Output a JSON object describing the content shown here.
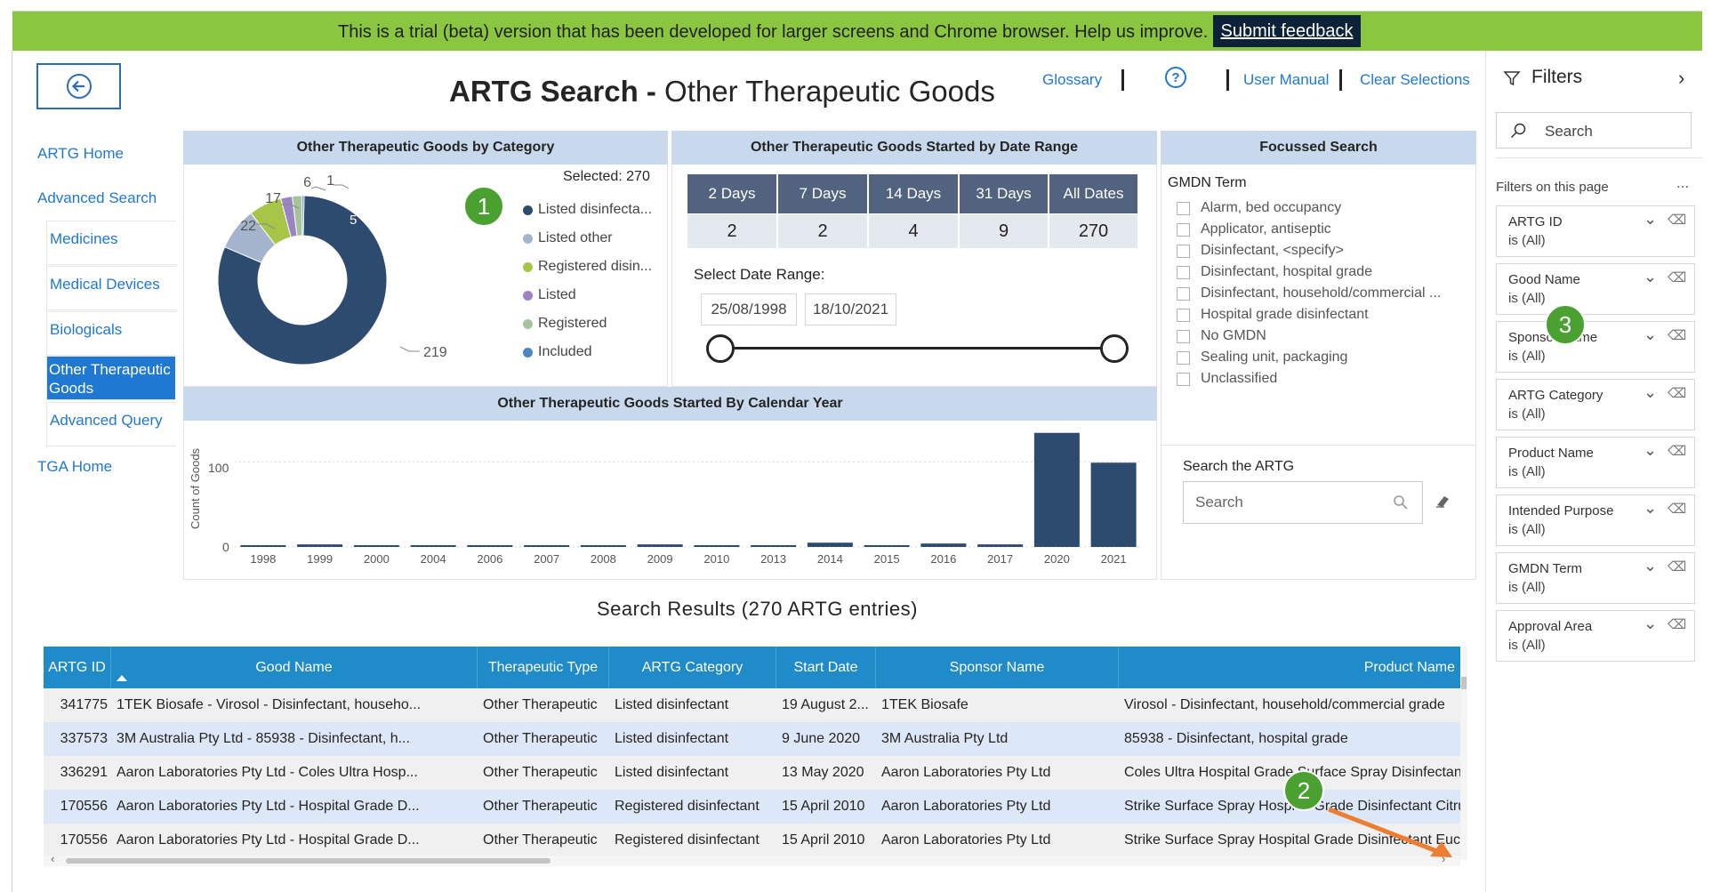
{
  "banner": {
    "text": "This is a trial (beta) version that has been developed for larger screens and Chrome browser. Help us improve.",
    "feedback_label": "Submit feedback"
  },
  "header": {
    "title_bold": "ARTG Search -",
    "title_rest": " Other Therapeutic Goods",
    "glossary": "Glossary",
    "help": "?",
    "user_manual": "User Manual",
    "clear_selections": "Clear Selections"
  },
  "sidebar": {
    "artg_home": "ARTG Home",
    "advanced_search": "Advanced Search",
    "items": [
      "Medicines",
      "Medical Devices",
      "Biologicals",
      "Other Therapeutic Goods",
      "Advanced Query"
    ],
    "tga_home": "TGA Home"
  },
  "category_panel": {
    "title": "Other Therapeutic Goods by Category",
    "selected": "Selected: 270",
    "legend": [
      {
        "label": "Listed disinfecta...",
        "color": "#2d4a6f"
      },
      {
        "label": "Listed other",
        "color": "#a4b4cd"
      },
      {
        "label": "Registered disin...",
        "color": "#a7c648"
      },
      {
        "label": "Listed",
        "color": "#9b84c3"
      },
      {
        "label": "Registered",
        "color": "#a6c49a"
      },
      {
        "label": "Included",
        "color": "#4a86c6"
      }
    ],
    "data_labels": [
      "17",
      "6",
      "1",
      "5",
      "22",
      "219"
    ]
  },
  "chart_data": {
    "type": "pie",
    "title": "Other Therapeutic Goods by Category",
    "categories": [
      "Listed disinfectant",
      "Listed other",
      "Registered disinfectant",
      "Listed",
      "Registered",
      "Included"
    ],
    "values": [
      219,
      22,
      17,
      6,
      5,
      1
    ]
  },
  "date_panel": {
    "title": "Other Therapeutic Goods Started by Date Range",
    "tabs": [
      {
        "label": "2 Days",
        "value": "2"
      },
      {
        "label": "7 Days",
        "value": "2"
      },
      {
        "label": "14 Days",
        "value": "4"
      },
      {
        "label": "31 Days",
        "value": "9"
      },
      {
        "label": "All Dates",
        "value": "270"
      }
    ],
    "select_label": "Select Date Range:",
    "start_date": "25/08/1998",
    "end_date": "18/10/2021"
  },
  "focus_panel": {
    "title": "Focussed Search",
    "gmdn_label": "GMDN Term",
    "terms": [
      "Alarm, bed occupancy",
      "Applicator, antiseptic",
      "Disinfectant, <specify>",
      "Disinfectant, hospital grade",
      "Disinfectant, household/commercial ...",
      "Hospital grade disinfectant",
      "No GMDN",
      "Sealing unit, packaging",
      "Unclassified"
    ],
    "search_label": "Search the ARTG",
    "search_placeholder": "Search"
  },
  "year_chart": {
    "title": "Other Therapeutic Goods Started By Calendar Year",
    "ylabel": "Count of Goods",
    "yticks": [
      "100",
      "0"
    ],
    "years": [
      "1998",
      "1999",
      "2000",
      "2004",
      "2006",
      "2007",
      "2008",
      "2009",
      "2010",
      "2013",
      "2014",
      "2015",
      "2016",
      "2017",
      "2020",
      "2021"
    ],
    "values": [
      1,
      3,
      1,
      1,
      1,
      1,
      2,
      3,
      2,
      1,
      5,
      1,
      4,
      3,
      134,
      99
    ],
    "ymax": 140
  },
  "results": {
    "title": "Search Results (270 ARTG entries)",
    "columns": [
      "ARTG ID",
      "Good Name",
      "Therapeutic Type",
      "ARTG Category",
      "Start Date",
      "Sponsor Name",
      "Product Name"
    ],
    "rows": [
      [
        "341775",
        "1TEK Biosafe - Virosol - Disinfectant, househo...",
        "Other Therapeutic",
        "Listed disinfectant",
        "19 August 2...",
        "1TEK Biosafe",
        "Virosol - Disinfectant, household/commercial grade"
      ],
      [
        "337573",
        "3M Australia Pty Ltd - 85938 - Disinfectant, h...",
        "Other Therapeutic",
        "Listed disinfectant",
        "9 June 2020",
        "3M Australia Pty Ltd",
        "85938 - Disinfectant, hospital grade"
      ],
      [
        "336291",
        "Aaron Laboratories Pty Ltd - Coles Ultra Hosp...",
        "Other Therapeutic",
        "Listed disinfectant",
        "13 May 2020",
        "Aaron Laboratories Pty Ltd",
        "Coles Ultra Hospital Grade Surface Spray Disinfectant - Di"
      ],
      [
        "170556",
        "Aaron Laboratories Pty Ltd - Hospital Grade D...",
        "Other Therapeutic",
        "Registered disinfectant",
        "15 April 2010",
        "Aaron Laboratories Pty Ltd",
        "Strike Surface Spray Hospital Grade Disinfectant Citrus Fre"
      ],
      [
        "170556",
        "Aaron Laboratories Pty Ltd - Hospital Grade D...",
        "Other Therapeutic",
        "Registered disinfectant",
        "15 April 2010",
        "Aaron Laboratories Pty Ltd",
        "Strike Surface Spray Hospital Grade Disinfectant Eucalyptu"
      ]
    ]
  },
  "filters": {
    "title": "Filters",
    "search_placeholder": "Search",
    "on_page_label": "Filters on this page",
    "more": "...",
    "cards": [
      {
        "name": "ARTG ID",
        "value": "is (All)"
      },
      {
        "name": "Good Name",
        "value": "is (All)"
      },
      {
        "name": "Sponsor Name",
        "value": "is (All)"
      },
      {
        "name": "ARTG Category",
        "value": "is (All)"
      },
      {
        "name": "Product Name",
        "value": "is (All)"
      },
      {
        "name": "Intended Purpose",
        "value": "is (All)"
      },
      {
        "name": "GMDN Term",
        "value": "is (All)"
      },
      {
        "name": "Approval Area",
        "value": "is (All)"
      }
    ]
  },
  "annotations": {
    "badge1": "1",
    "badge2": "2",
    "badge3": "3",
    "arrow_color": "#ed7d31",
    "badge_color": "#4aa132"
  }
}
